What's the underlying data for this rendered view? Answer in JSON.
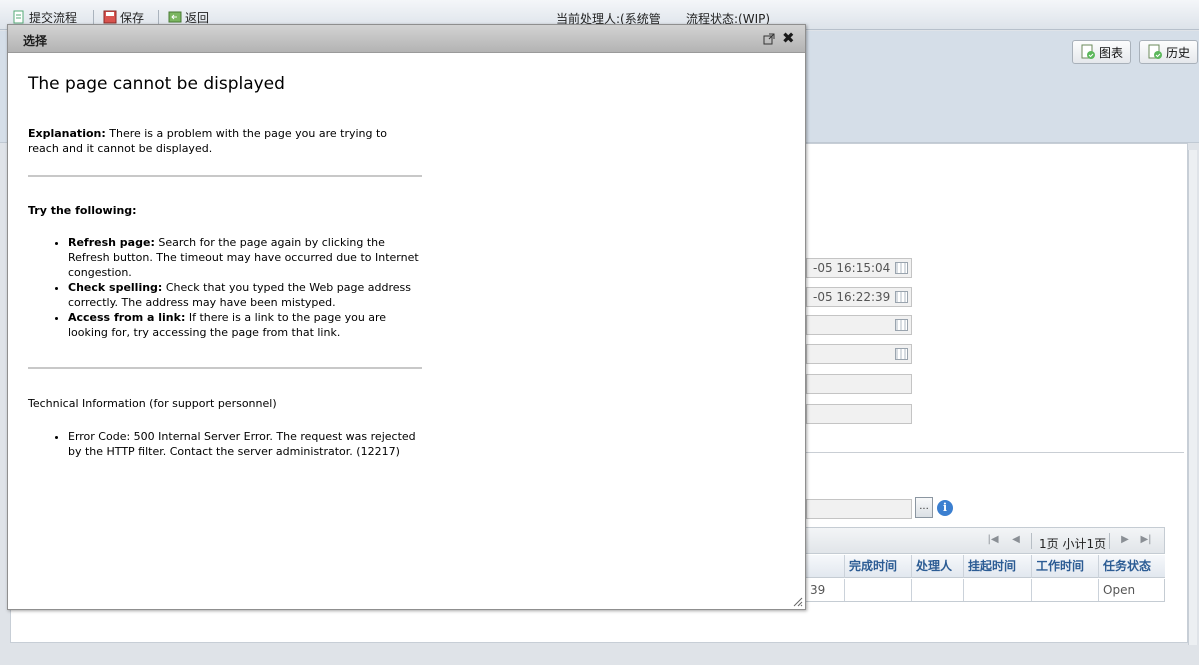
{
  "toolbar": {
    "submit_label": "提交流程",
    "save_label": "保存",
    "back_label": "返回",
    "handler_text": "当前处理人:(系统管",
    "status_text": "流程状态:(WIP)"
  },
  "header": {
    "chart_label": "图表",
    "history_label": "历史"
  },
  "form": {
    "date_1": "-05 16:15:04",
    "date_2": "-05 16:22:39"
  },
  "grid": {
    "pager_text": "1页 小计1页",
    "columns": [
      "完成时间",
      "处理人",
      "挂起时间",
      "工作时间",
      "任务状态"
    ],
    "row": {
      "partial": "39",
      "status": "Open"
    }
  },
  "dialog": {
    "title": "选择",
    "heading": "The page cannot be displayed",
    "explanation_label": "Explanation:",
    "explanation_text": " There is a problem with the page you are trying to reach and it cannot be displayed.",
    "try_heading": "Try the following:",
    "tips": [
      {
        "label": "Refresh page:",
        "text": " Search for the page again by clicking the Refresh button. The timeout may have occurred due to Internet congestion."
      },
      {
        "label": "Check spelling:",
        "text": " Check that you typed the Web page address correctly. The address may have been mistyped."
      },
      {
        "label": "Access from a link:",
        "text": " If there is a link to the page you are looking for, try accessing the page from that link."
      }
    ],
    "tech_heading": "Technical Information (for support personnel)",
    "tech_error": "Error Code: 500 Internal Server Error. The request was rejected by the HTTP filter. Contact the server administrator. (12217)"
  }
}
